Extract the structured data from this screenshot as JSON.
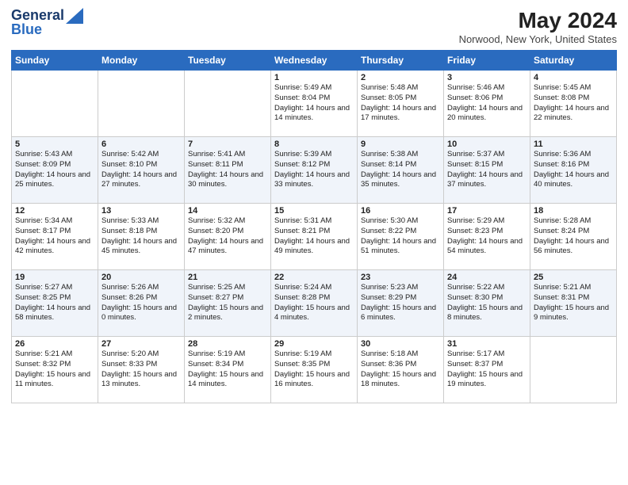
{
  "header": {
    "logo_line1": "General",
    "logo_line2": "Blue",
    "month_year": "May 2024",
    "location": "Norwood, New York, United States"
  },
  "days_of_week": [
    "Sunday",
    "Monday",
    "Tuesday",
    "Wednesday",
    "Thursday",
    "Friday",
    "Saturday"
  ],
  "weeks": [
    [
      {
        "day": "",
        "info": ""
      },
      {
        "day": "",
        "info": ""
      },
      {
        "day": "",
        "info": ""
      },
      {
        "day": "1",
        "info": "Sunrise: 5:49 AM\nSunset: 8:04 PM\nDaylight: 14 hours and 14 minutes."
      },
      {
        "day": "2",
        "info": "Sunrise: 5:48 AM\nSunset: 8:05 PM\nDaylight: 14 hours and 17 minutes."
      },
      {
        "day": "3",
        "info": "Sunrise: 5:46 AM\nSunset: 8:06 PM\nDaylight: 14 hours and 20 minutes."
      },
      {
        "day": "4",
        "info": "Sunrise: 5:45 AM\nSunset: 8:08 PM\nDaylight: 14 hours and 22 minutes."
      }
    ],
    [
      {
        "day": "5",
        "info": "Sunrise: 5:43 AM\nSunset: 8:09 PM\nDaylight: 14 hours and 25 minutes."
      },
      {
        "day": "6",
        "info": "Sunrise: 5:42 AM\nSunset: 8:10 PM\nDaylight: 14 hours and 27 minutes."
      },
      {
        "day": "7",
        "info": "Sunrise: 5:41 AM\nSunset: 8:11 PM\nDaylight: 14 hours and 30 minutes."
      },
      {
        "day": "8",
        "info": "Sunrise: 5:39 AM\nSunset: 8:12 PM\nDaylight: 14 hours and 33 minutes."
      },
      {
        "day": "9",
        "info": "Sunrise: 5:38 AM\nSunset: 8:14 PM\nDaylight: 14 hours and 35 minutes."
      },
      {
        "day": "10",
        "info": "Sunrise: 5:37 AM\nSunset: 8:15 PM\nDaylight: 14 hours and 37 minutes."
      },
      {
        "day": "11",
        "info": "Sunrise: 5:36 AM\nSunset: 8:16 PM\nDaylight: 14 hours and 40 minutes."
      }
    ],
    [
      {
        "day": "12",
        "info": "Sunrise: 5:34 AM\nSunset: 8:17 PM\nDaylight: 14 hours and 42 minutes."
      },
      {
        "day": "13",
        "info": "Sunrise: 5:33 AM\nSunset: 8:18 PM\nDaylight: 14 hours and 45 minutes."
      },
      {
        "day": "14",
        "info": "Sunrise: 5:32 AM\nSunset: 8:20 PM\nDaylight: 14 hours and 47 minutes."
      },
      {
        "day": "15",
        "info": "Sunrise: 5:31 AM\nSunset: 8:21 PM\nDaylight: 14 hours and 49 minutes."
      },
      {
        "day": "16",
        "info": "Sunrise: 5:30 AM\nSunset: 8:22 PM\nDaylight: 14 hours and 51 minutes."
      },
      {
        "day": "17",
        "info": "Sunrise: 5:29 AM\nSunset: 8:23 PM\nDaylight: 14 hours and 54 minutes."
      },
      {
        "day": "18",
        "info": "Sunrise: 5:28 AM\nSunset: 8:24 PM\nDaylight: 14 hours and 56 minutes."
      }
    ],
    [
      {
        "day": "19",
        "info": "Sunrise: 5:27 AM\nSunset: 8:25 PM\nDaylight: 14 hours and 58 minutes."
      },
      {
        "day": "20",
        "info": "Sunrise: 5:26 AM\nSunset: 8:26 PM\nDaylight: 15 hours and 0 minutes."
      },
      {
        "day": "21",
        "info": "Sunrise: 5:25 AM\nSunset: 8:27 PM\nDaylight: 15 hours and 2 minutes."
      },
      {
        "day": "22",
        "info": "Sunrise: 5:24 AM\nSunset: 8:28 PM\nDaylight: 15 hours and 4 minutes."
      },
      {
        "day": "23",
        "info": "Sunrise: 5:23 AM\nSunset: 8:29 PM\nDaylight: 15 hours and 6 minutes."
      },
      {
        "day": "24",
        "info": "Sunrise: 5:22 AM\nSunset: 8:30 PM\nDaylight: 15 hours and 8 minutes."
      },
      {
        "day": "25",
        "info": "Sunrise: 5:21 AM\nSunset: 8:31 PM\nDaylight: 15 hours and 9 minutes."
      }
    ],
    [
      {
        "day": "26",
        "info": "Sunrise: 5:21 AM\nSunset: 8:32 PM\nDaylight: 15 hours and 11 minutes."
      },
      {
        "day": "27",
        "info": "Sunrise: 5:20 AM\nSunset: 8:33 PM\nDaylight: 15 hours and 13 minutes."
      },
      {
        "day": "28",
        "info": "Sunrise: 5:19 AM\nSunset: 8:34 PM\nDaylight: 15 hours and 14 minutes."
      },
      {
        "day": "29",
        "info": "Sunrise: 5:19 AM\nSunset: 8:35 PM\nDaylight: 15 hours and 16 minutes."
      },
      {
        "day": "30",
        "info": "Sunrise: 5:18 AM\nSunset: 8:36 PM\nDaylight: 15 hours and 18 minutes."
      },
      {
        "day": "31",
        "info": "Sunrise: 5:17 AM\nSunset: 8:37 PM\nDaylight: 15 hours and 19 minutes."
      },
      {
        "day": "",
        "info": ""
      }
    ]
  ]
}
